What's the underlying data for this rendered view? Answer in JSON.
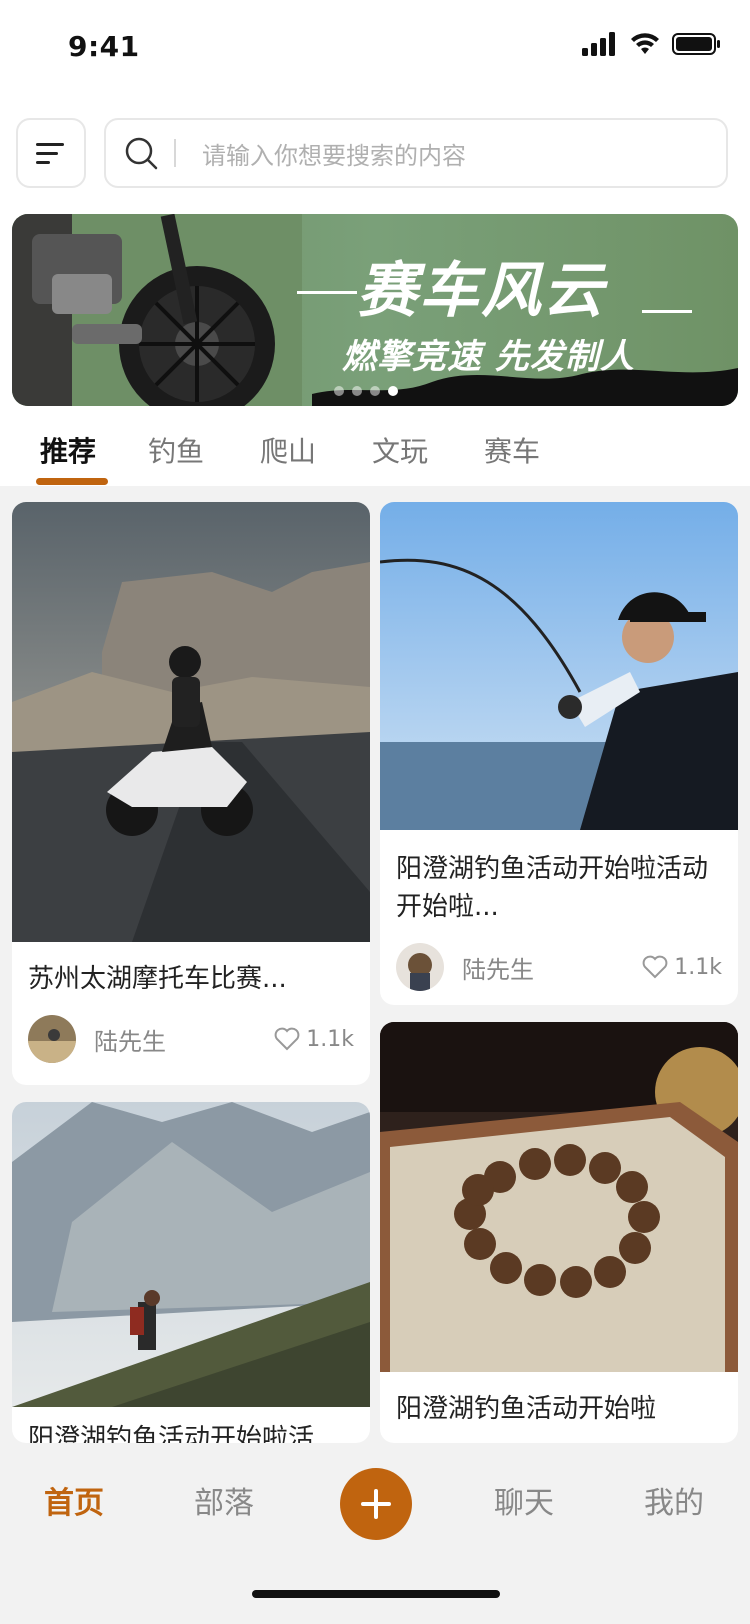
{
  "status": {
    "time": "9:41"
  },
  "search": {
    "placeholder": "请输入你想要搜索的内容"
  },
  "banner": {
    "title": "赛车风云",
    "subtitle": "燃擎竞速 先发制人",
    "dots_total": 4,
    "active_dot": 4
  },
  "tabs": {
    "items": [
      "推荐",
      "钓鱼",
      "爬山",
      "文玩",
      "赛车"
    ],
    "active_index": 0
  },
  "feed": {
    "cards": [
      {
        "title": "苏州太湖摩托车比赛...",
        "author": "陆先生",
        "likes": "1.1k"
      },
      {
        "title": "阳澄湖钓鱼活动开始啦活动开始啦...",
        "author": "陆先生",
        "likes": "1.1k"
      },
      {
        "title": "阳澄湖钓鱼活动开始啦活..."
      },
      {
        "title": "阳澄湖钓鱼活动开始啦"
      }
    ]
  },
  "bottom_nav": {
    "items": [
      "首页",
      "部落",
      "聊天",
      "我的"
    ],
    "active_index": 0
  },
  "colors": {
    "accent": "#c0640f",
    "banner_green": "#77997a"
  }
}
